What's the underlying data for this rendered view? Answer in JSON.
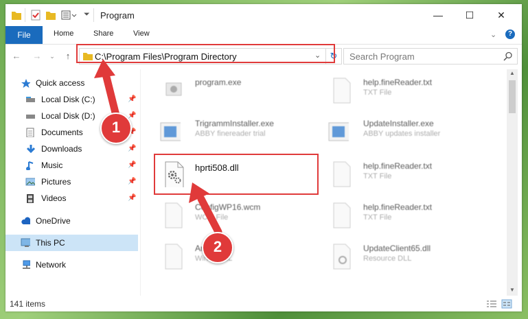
{
  "window": {
    "title": "Program"
  },
  "ribbon": {
    "tabs": [
      "File",
      "Home",
      "Share",
      "View"
    ]
  },
  "address": {
    "path": "C:\\Program Files\\Program Directory"
  },
  "search": {
    "placeholder": "Search Program"
  },
  "sidebar": {
    "items": [
      {
        "label": "Quick access",
        "icon": "star-icon"
      },
      {
        "label": "Local Disk (C:)",
        "icon": "drive-icon",
        "pinned": true
      },
      {
        "label": "Local Disk (D:)",
        "icon": "drive-icon",
        "pinned": true
      },
      {
        "label": "Documents",
        "icon": "documents-icon",
        "pinned": true
      },
      {
        "label": "Downloads",
        "icon": "download-icon",
        "pinned": true
      },
      {
        "label": "Music",
        "icon": "music-icon",
        "pinned": true
      },
      {
        "label": "Pictures",
        "icon": "pictures-icon",
        "pinned": true
      },
      {
        "label": "Videos",
        "icon": "videos-icon",
        "pinned": true
      },
      {
        "label": "OneDrive",
        "icon": "cloud-icon"
      },
      {
        "label": "This PC",
        "icon": "computer-icon",
        "selected": true
      },
      {
        "label": "Network",
        "icon": "network-icon"
      }
    ]
  },
  "files": [
    {
      "name": "program.exe",
      "type": ""
    },
    {
      "name": "help.fineReader.txt",
      "type": "TXT File"
    },
    {
      "name": "TrigrammInstaller.exe",
      "type": "ABBY finereader trial"
    },
    {
      "name": "UpdateInstaller.exe",
      "type": "ABBY updates installer"
    },
    {
      "name": "hprti508.dll",
      "type": ""
    },
    {
      "name": "help.fineReader.txt",
      "type": "TXT File"
    },
    {
      "name": "ConfigWP16.wcm",
      "type": "WCM File"
    },
    {
      "name": "help.fineReader.txt",
      "type": "TXT File"
    },
    {
      "name": "Arabic.dll",
      "type": "Win32 DLL"
    },
    {
      "name": "UpdateClient65.dll",
      "type": "Resource DLL"
    }
  ],
  "status": {
    "count": "141 items"
  },
  "annotations": {
    "step1": "1",
    "step2": "2"
  },
  "colors": {
    "accent": "#1a6bbd",
    "highlight": "#e03a3a"
  }
}
